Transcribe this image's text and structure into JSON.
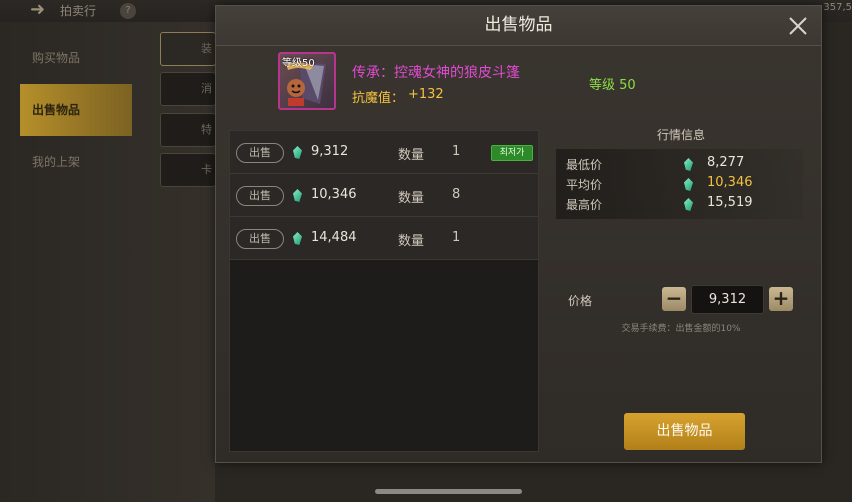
{
  "background": {
    "title": "拍卖行",
    "help_icon": "?",
    "currency_text": "357,5",
    "left_menu": [
      {
        "label": "购买物品"
      },
      {
        "label": "出售物品"
      },
      {
        "label": "我的上架"
      }
    ],
    "left_tabs": [
      "装",
      "消",
      "特",
      "卡"
    ]
  },
  "popup": {
    "title": "出售物品",
    "close_icon": "close-icon"
  },
  "item": {
    "level_badge": "等级50",
    "name": "传承：控魂女神的狼皮斗篷",
    "stat_label": "抗魔值：",
    "stat_value": "+132",
    "grade": "等级 50",
    "border_color": "#b8358e",
    "name_color": "#e14bd1"
  },
  "listings": {
    "sell_label": "出售",
    "qty_label": "数量",
    "lowest_badge": "최저가",
    "rows": [
      {
        "price": "9,312",
        "qty": "1"
      },
      {
        "price": "10,346",
        "qty": "8"
      },
      {
        "price": "14,484",
        "qty": "1"
      }
    ]
  },
  "market": {
    "title": "行情信息",
    "rows": [
      {
        "label": "最低价",
        "value": "8,277"
      },
      {
        "label": "平均价",
        "value": "10,346"
      },
      {
        "label": "最高价",
        "value": "15,519"
      }
    ]
  },
  "price": {
    "label": "价格",
    "value": "9,312",
    "minus": "−",
    "plus": "+",
    "fee_note": "交易手续费：出售金额的10%"
  },
  "action": {
    "sell_button": "出售物品"
  },
  "colors": {
    "accent_gold": "#d7a22e",
    "gem_green": "#2fc08e",
    "grade_green": "#8cde45",
    "stat_yellow": "#f2c240"
  }
}
